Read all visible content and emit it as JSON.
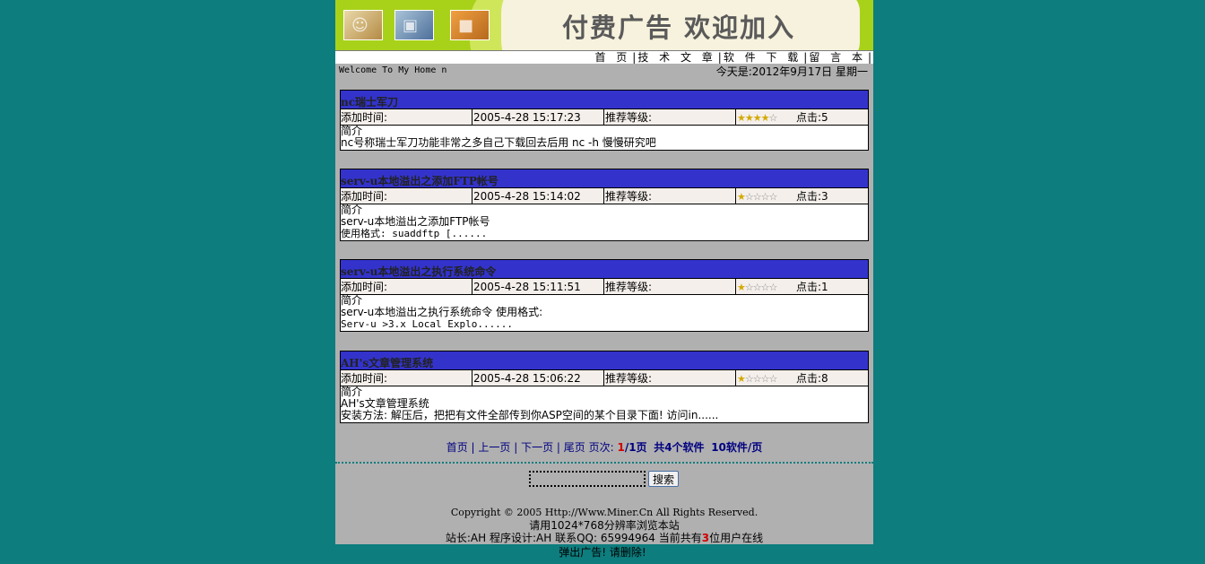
{
  "banner": {
    "text": "付费广告 欢迎加入",
    "thumbs": [
      "person-photo-icon",
      "computer-photo-icon",
      "box-photo-icon"
    ]
  },
  "nav": {
    "items": [
      "首 页",
      "技 术 文 章",
      "软 件 下 载",
      "留 言 本"
    ]
  },
  "welcome": "Welcome To My Home n",
  "date": "今天是:2012年9月17日  星期一",
  "articles": [
    {
      "title": "nc瑞士军刀",
      "added_label": "添加时间:",
      "added": "2005-4-28 15:17:23",
      "rating_label": "推荐等级:",
      "stars": 4,
      "clicks": "点击:5",
      "intro_label": "简介",
      "lines": [
        "nc号称瑞士军刀功能非常之多自己下载回去后用 nc -h 慢慢研究吧"
      ]
    },
    {
      "title": "serv-u本地溢出之添加FTP帐号",
      "added_label": "添加时间:",
      "added": "2005-4-28 15:14:02",
      "rating_label": "推荐等级:",
      "stars": 1,
      "clicks": "点击:3",
      "intro_label": "简介",
      "lines": [
        "serv-u本地溢出之添加FTP帐号",
        "使用格式:  suaddftp [......"
      ]
    },
    {
      "title": "serv-u本地溢出之执行系统命令",
      "added_label": "添加时间:",
      "added": "2005-4-28 15:11:51",
      "rating_label": "推荐等级:",
      "stars": 1,
      "clicks": "点击:1",
      "intro_label": "简介",
      "lines": [
        "serv-u本地溢出之执行系统命令 使用格式:",
        "Serv-u >3.x Local Explo......"
      ]
    },
    {
      "title": "AH's文章管理系统",
      "added_label": "添加时间:",
      "added": "2005-4-28 15:06:22",
      "rating_label": "推荐等级:",
      "stars": 1,
      "clicks": "点击:8",
      "intro_label": "简介",
      "lines": [
        "AH's文章管理系统",
        "安装方法: 解压后，把把有文件全部传到你ASP空间的某个目录下面! 访问in......"
      ]
    }
  ],
  "pager": {
    "first": "首页",
    "prev": "上一页",
    "next": "下一页",
    "last": "尾页",
    "page_label": "页次:",
    "current": "1",
    "total": "/1页",
    "count_text": "共4个软件",
    "per_page": "10软件/页"
  },
  "search": {
    "value": "",
    "button": "搜索"
  },
  "footer": {
    "copyright": "Copyright © 2005 Http://Www.Miner.Cn All Rights Reserved.",
    "resolution": "请用1024*768分辨率浏览本站",
    "admin_prefix": "站长:AH 程序设计:AH 联系QQ: 65994964 当前共有",
    "online_count": "3",
    "admin_suffix": "位用户在线",
    "popup_note": "弹出广告! 请删除!"
  },
  "colors": {
    "page_bg": "#0d7d7e",
    "title_bar": "#3333cc",
    "content_bg": "#b0b0b0"
  }
}
